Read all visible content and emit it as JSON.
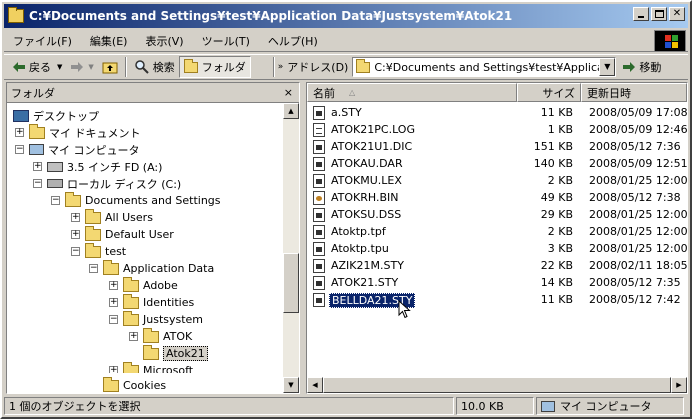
{
  "window": {
    "title": "C:¥Documents and Settings¥test¥Application Data¥Justsystem¥Atok21"
  },
  "menu": {
    "items": [
      "ファイル(F)",
      "編集(E)",
      "表示(V)",
      "ツール(T)",
      "ヘルプ(H)"
    ]
  },
  "toolbar": {
    "back_label": "戻る",
    "search_label": "検索",
    "folders_label": "フォルダ",
    "address_label": "アドレス(D)",
    "address_value": "C:¥Documents and Settings¥test¥Application Da",
    "go_label": "移動"
  },
  "tree": {
    "header": "フォルダ",
    "close_glyph": "×",
    "nodes": [
      {
        "label": "デスクトップ"
      },
      {
        "label": "マイ ドキュメント"
      },
      {
        "label": "マイ コンピュータ"
      },
      {
        "label": "3.5 インチ FD (A:)"
      },
      {
        "label": "ローカル ディスク (C:)"
      },
      {
        "label": "Documents and Settings"
      },
      {
        "label": "All Users"
      },
      {
        "label": "Default User"
      },
      {
        "label": "test"
      },
      {
        "label": "Application Data"
      },
      {
        "label": "Adobe"
      },
      {
        "label": "Identities"
      },
      {
        "label": "Justsystem"
      },
      {
        "label": "ATOK"
      },
      {
        "label": "Atok21"
      },
      {
        "label": "Microsoft"
      },
      {
        "label": "Cookies"
      }
    ]
  },
  "list": {
    "columns": {
      "name": "名前",
      "size": "サイズ",
      "date": "更新日時"
    },
    "sort_glyph": "△",
    "files": [
      {
        "name": "a.STY",
        "size": "11 KB",
        "date": "2008/05/09 17:08",
        "icon": "sty"
      },
      {
        "name": "ATOK21PC.LOG",
        "size": "1 KB",
        "date": "2008/05/09 12:46",
        "icon": "txt"
      },
      {
        "name": "ATOK21U1.DIC",
        "size": "151 KB",
        "date": "2008/05/12 7:36",
        "icon": "sty"
      },
      {
        "name": "ATOKAU.DAR",
        "size": "140 KB",
        "date": "2008/05/09 12:51",
        "icon": "sty"
      },
      {
        "name": "ATOKMU.LEX",
        "size": "2 KB",
        "date": "2008/01/25 12:00",
        "icon": "sty"
      },
      {
        "name": "ATOKRH.BIN",
        "size": "49 KB",
        "date": "2008/05/12 7:38",
        "icon": "bin"
      },
      {
        "name": "ATOKSU.DSS",
        "size": "29 KB",
        "date": "2008/01/25 12:00",
        "icon": "sty"
      },
      {
        "name": "Atoktp.tpf",
        "size": "2 KB",
        "date": "2008/01/25 12:00",
        "icon": "sty"
      },
      {
        "name": "Atoktp.tpu",
        "size": "3 KB",
        "date": "2008/01/25 12:00",
        "icon": "sty"
      },
      {
        "name": "AZIK21M.STY",
        "size": "22 KB",
        "date": "2008/02/11 18:05",
        "icon": "sty"
      },
      {
        "name": "ATOK21.STY",
        "size": "14 KB",
        "date": "2008/05/12 7:35",
        "icon": "sty"
      },
      {
        "name": "BELLDA21.STY",
        "size": "11 KB",
        "date": "2008/05/12 7:42",
        "icon": "sty",
        "selected": true
      }
    ]
  },
  "status": {
    "selection": "1 個のオブジェクトを選択",
    "size": "10.0 KB",
    "location": "マイ コンピュータ"
  }
}
